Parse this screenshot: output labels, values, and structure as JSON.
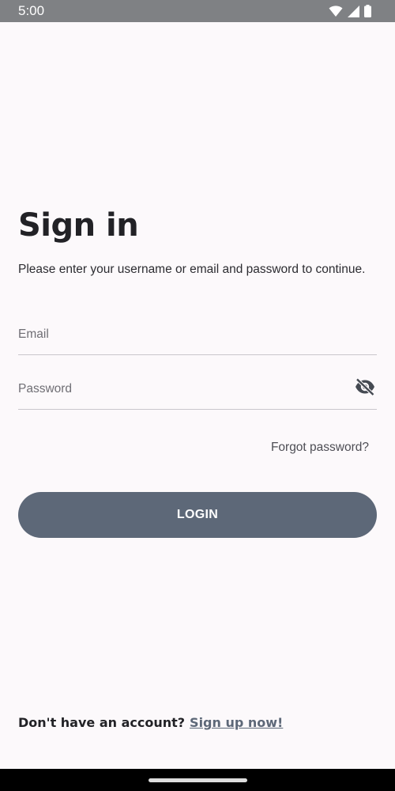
{
  "status_bar": {
    "time": "5:00",
    "icons": [
      "wifi-icon",
      "signal-icon",
      "battery-icon"
    ]
  },
  "signin": {
    "title": "Sign in",
    "subtitle": "Please enter your username or email and password to continue.",
    "email": {
      "value": "",
      "placeholder": "Email"
    },
    "password": {
      "value": "",
      "placeholder": "Password",
      "toggle_icon": "eye-off-icon"
    },
    "forgot_password": "Forgot password?",
    "login_button": "LOGIN",
    "signup_prompt": "Don't have an account?",
    "signup_link": "Sign up now!"
  },
  "colors": {
    "background": "#fcf9fb",
    "status_bar": "#7f8184",
    "primary_button": "#5d6878",
    "link": "#5d6878",
    "divider": "#c9c7cc"
  }
}
